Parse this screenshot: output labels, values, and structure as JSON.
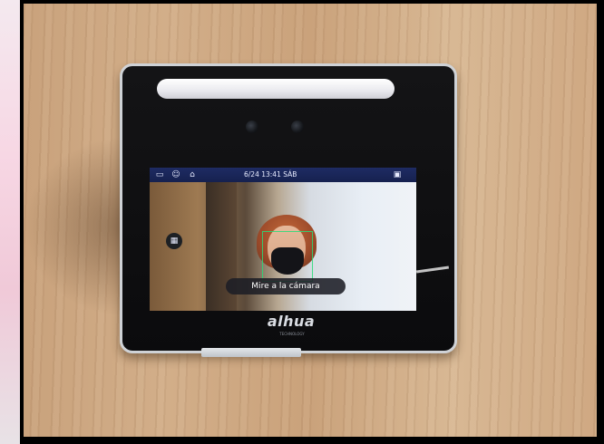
{
  "device": {
    "screen": {
      "status_bar": {
        "datetime": "6/24 13:41 SÁB"
      },
      "prompt": "Mire a la cámara"
    },
    "brand": {
      "logo": "alhua",
      "tagline": "TECHNOLOGY"
    }
  },
  "icons": {
    "status_left": [
      "card-icon",
      "user-icon",
      "lock-icon"
    ],
    "status_right": "network-icon",
    "side": "keypad-icon"
  },
  "colors": {
    "status_bar": "#1e2b63",
    "face_box": "#28dc78",
    "prompt_bg": "#1c1e26",
    "bezel": "#0b0b0d"
  }
}
